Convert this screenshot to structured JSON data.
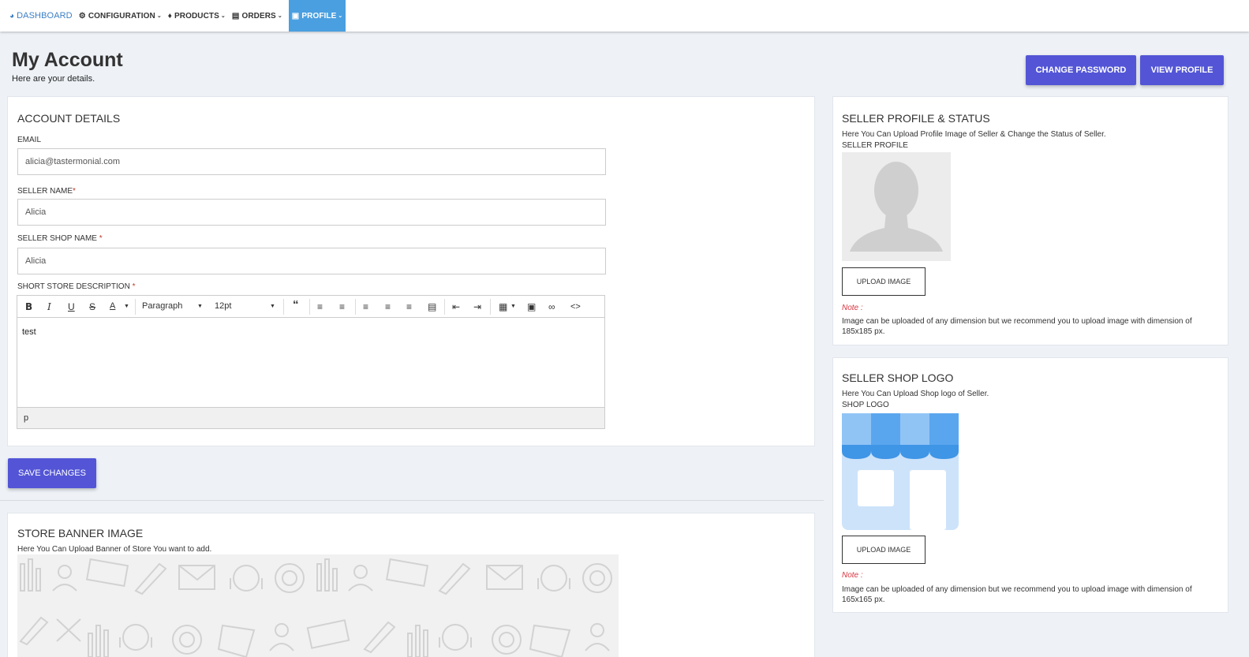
{
  "nav": {
    "dashboard": "DASHBOARD",
    "configuration": "CONFIGURATION",
    "products": "PRODUCTS",
    "orders": "ORDERS",
    "profile": "PROFILE"
  },
  "header": {
    "title": "My Account",
    "subtitle": "Here are your details.",
    "change_password": "CHANGE PASSWORD",
    "view_profile": "VIEW PROFILE"
  },
  "account": {
    "title": "ACCOUNT DETAILS",
    "email_label": "EMAIL",
    "email_value": "alicia@tastermonial.com",
    "seller_name_label": "SELLER NAME",
    "seller_name_value": "Alicia",
    "shop_name_label": "SELLER SHOP NAME ",
    "shop_name_value": "Alicia",
    "desc_label": "SHORT STORE DESCRIPTION ",
    "required_mark": "*"
  },
  "editor": {
    "block_format": "Paragraph",
    "font_size": "12pt",
    "content": "test",
    "status_path": "p"
  },
  "save_button": "SAVE CHANGES",
  "banner": {
    "title": "STORE BANNER IMAGE",
    "desc": "Here You Can Upload Banner of Store You want to add."
  },
  "profile_panel": {
    "title": "SELLER PROFILE & STATUS",
    "desc": "Here You Can Upload Profile Image of Seller & Change the Status of Seller.",
    "label": "SELLER PROFILE",
    "upload": "UPLOAD IMAGE",
    "note_label": "Note :",
    "note_text": "Image can be uploaded of any dimension but we recommend you to upload image with dimension of 185x185 px."
  },
  "logo_panel": {
    "title": "SELLER SHOP LOGO",
    "desc": "Here You Can Upload Shop logo of Seller.",
    "label": "SHOP LOGO",
    "upload": "UPLOAD IMAGE",
    "note_label": "Note :",
    "note_text": "Image can be uploaded of any dimension but we recommend you to upload image with dimension of 165x165 px."
  },
  "colors": {
    "primary": "#5355d6",
    "nav_active": "#4a9fe0",
    "note": "#d9333f"
  }
}
